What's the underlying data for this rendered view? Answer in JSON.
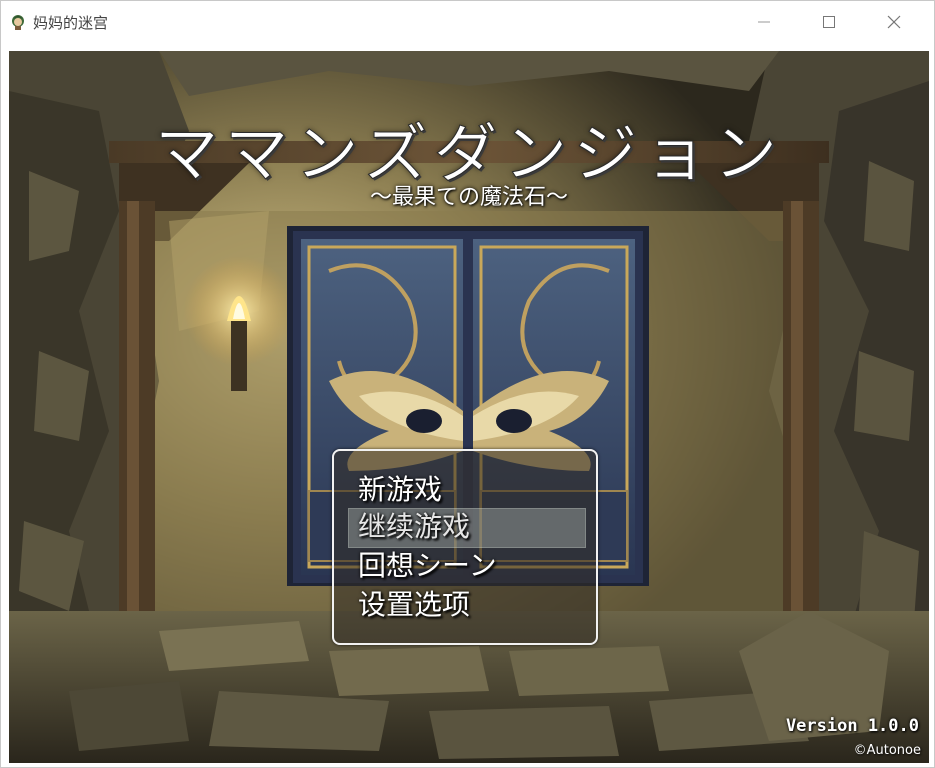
{
  "window": {
    "title": "妈妈的迷宫",
    "app_icon": "game-app-icon",
    "controls": [
      "minimize-icon",
      "maximize-icon",
      "close-icon"
    ]
  },
  "game": {
    "title": "ママンズダンジョン",
    "subtitle": "〜最果ての魔法石〜",
    "menu": {
      "items": [
        {
          "label": "新游戏"
        },
        {
          "label": "继续游戏"
        },
        {
          "label": "回想シーン"
        },
        {
          "label": "设置选项"
        }
      ],
      "selected_index": 1
    },
    "version": "Version 1.0.0",
    "copyright": "©Autonoe"
  },
  "colors": {
    "menu_border": "#f2f2f2",
    "door_blue": "#34456a",
    "door_gold": "#c9a85a",
    "stone": "#5e5a48"
  }
}
